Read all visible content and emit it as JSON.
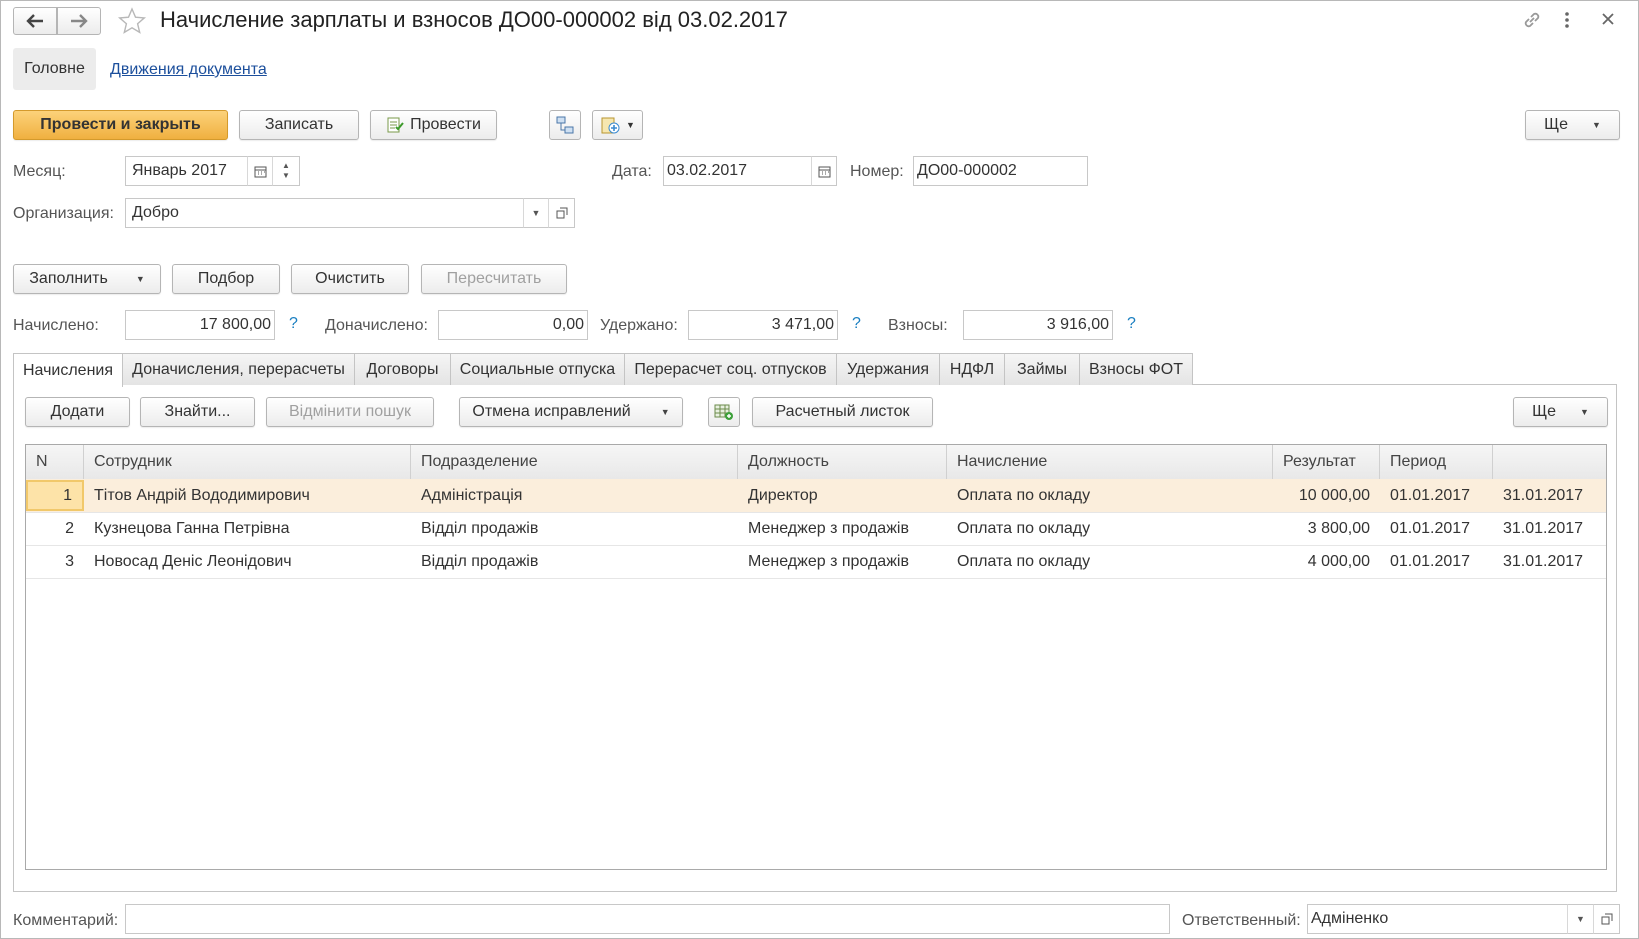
{
  "window": {
    "title": "Начисление зарплаты и взносов ДО00-000002 від 03.02.2017"
  },
  "nav_tabs": {
    "main": "Головне",
    "movements": "Движения документа"
  },
  "toolbar": {
    "post_close": "Провести и закрыть",
    "save": "Записать",
    "post": "Провести",
    "more": "Ще"
  },
  "header_fields": {
    "month_label": "Месяц:",
    "month_value": "Январь 2017",
    "date_label": "Дата:",
    "date_value": "03.02.2017",
    "number_label": "Номер:",
    "number_value": "ДО00-000002",
    "org_label": "Организация:",
    "org_value": "Добро"
  },
  "actions": {
    "fill": "Заполнить",
    "select": "Подбор",
    "clear": "Очистить",
    "recalc": "Пересчитать"
  },
  "totals": {
    "accrued_label": "Начислено:",
    "accrued_value": "17 800,00",
    "extra_label": "Доначислено:",
    "extra_value": "0,00",
    "withheld_label": "Удержано:",
    "withheld_value": "3 471,00",
    "contrib_label": "Взносы:",
    "contrib_value": "3 916,00",
    "help": "?"
  },
  "tabs": [
    "Начисления",
    "Доначисления, перерасчеты",
    "Договоры",
    "Социальные отпуска",
    "Перерасчет соц. отпусков",
    "Удержания",
    "НДФЛ",
    "Займы",
    "Взносы ФОТ"
  ],
  "table_toolbar": {
    "add": "Додати",
    "find": "Знайти...",
    "cancel_search": "Відмінити пошук",
    "cancel_fixes": "Отмена исправлений",
    "payslip": "Расчетный листок",
    "more": "Ще"
  },
  "table": {
    "columns": [
      "N",
      "Сотрудник",
      "Подразделение",
      "Должность",
      "Начисление",
      "Результат",
      "Период",
      ""
    ],
    "rows": [
      [
        "1",
        "Тітов Андрій Вододимирович",
        "Адміністрація",
        "Директор",
        "Оплата по окладу",
        "10 000,00",
        "01.01.2017",
        "31.01.2017"
      ],
      [
        "2",
        "Кузнецова Ганна Петрівна",
        "Відділ продажів",
        "Менеджер з продажів",
        "Оплата по окладу",
        "3 800,00",
        "01.01.2017",
        "31.01.2017"
      ],
      [
        "3",
        "Новосад Деніс Леонідович",
        "Відділ продажів",
        "Менеджер з продажів",
        "Оплата по окладу",
        "4 000,00",
        "01.01.2017",
        "31.01.2017"
      ]
    ]
  },
  "footer": {
    "comment_label": "Комментарий:",
    "comment_value": "",
    "responsible_label": "Ответственный:",
    "responsible_value": "Адміненко"
  },
  "colors": {
    "primary_button": "#f0b040",
    "selected_row": "#fbeedc",
    "link": "#1c4f9c",
    "help": "#1a7fc1"
  }
}
